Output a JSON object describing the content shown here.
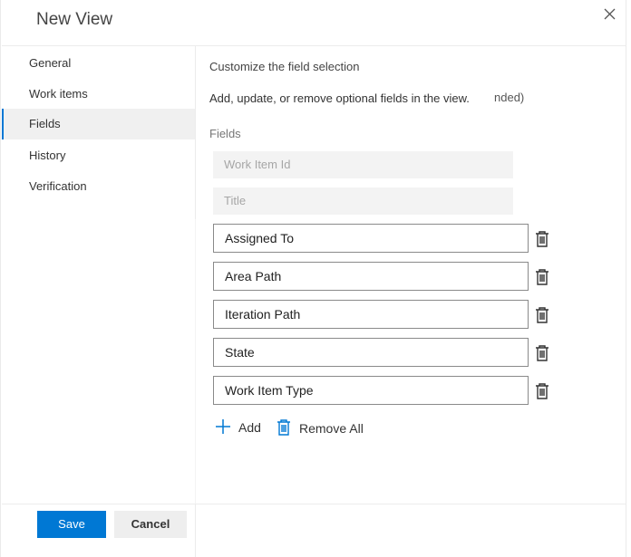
{
  "dialog": {
    "title": "New View"
  },
  "sidebar": {
    "items": [
      {
        "label": "General"
      },
      {
        "label": "Work items"
      },
      {
        "label": "Fields",
        "selected": true
      },
      {
        "label": "History"
      },
      {
        "label": "Verification"
      }
    ]
  },
  "main": {
    "section_title": "Customize the field selection",
    "description": "Add, update, or remove optional fields in the view.",
    "clipped_text": "nded)",
    "fields_label": "Fields",
    "required_fields": [
      {
        "placeholder": "Work Item Id"
      },
      {
        "placeholder": "Title"
      }
    ],
    "optional_fields": [
      {
        "value": "Assigned To"
      },
      {
        "value": "Area Path"
      },
      {
        "value": "Iteration Path"
      },
      {
        "value": "State"
      },
      {
        "value": "Work Item Type"
      }
    ],
    "add_label": "Add",
    "remove_all_label": "Remove All"
  },
  "footer": {
    "save_label": "Save",
    "cancel_label": "Cancel"
  },
  "icons": {
    "close": "close-icon",
    "delete": "trash-icon",
    "add": "plus-icon",
    "remove_all": "trash-icon"
  },
  "colors": {
    "accent": "#0078d4",
    "selected_bg": "#f0f0f0",
    "disabled_bg": "#f3f3f3",
    "input_border": "#8a8a8a"
  }
}
